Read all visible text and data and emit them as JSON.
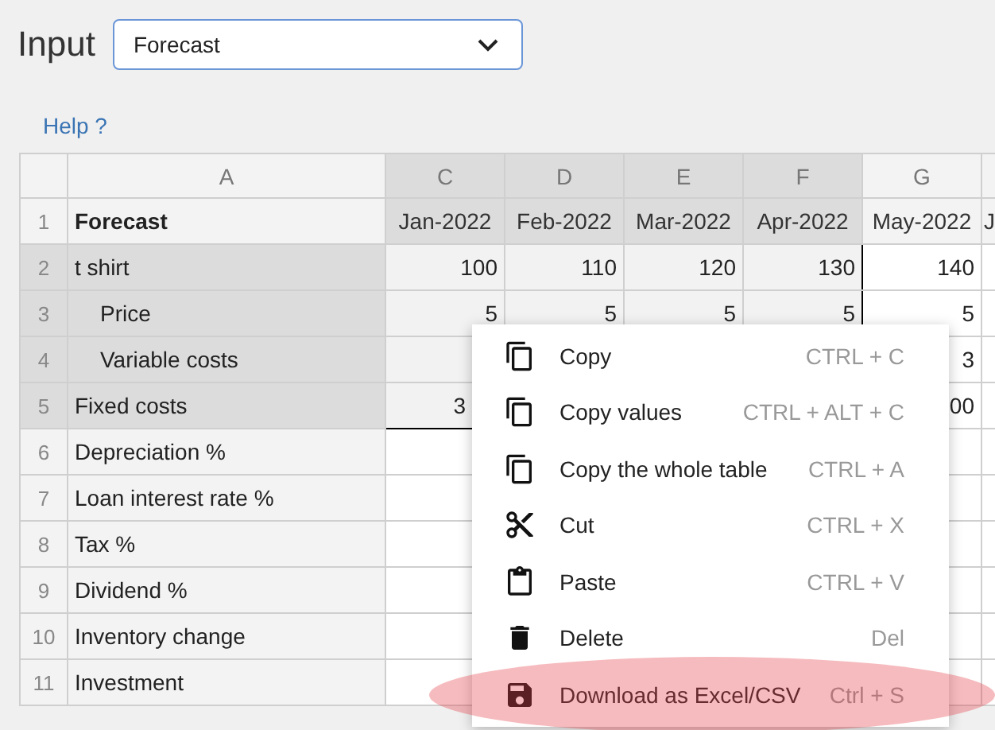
{
  "header": {
    "label": "Input",
    "select": {
      "value": "Forecast"
    }
  },
  "help_link": "Help ?",
  "sheet": {
    "columns": [
      {
        "label": "A",
        "selected": false
      },
      {
        "label": "C",
        "selected": true
      },
      {
        "label": "D",
        "selected": true
      },
      {
        "label": "E",
        "selected": true
      },
      {
        "label": "F",
        "selected": true
      },
      {
        "label": "G",
        "selected": false
      }
    ],
    "rows": [
      {
        "number": "1",
        "selected": false,
        "kind": "heading",
        "cells": [
          "Forecast",
          "Jan-2022",
          "Feb-2022",
          "Mar-2022",
          "Apr-2022",
          "May-2022",
          "J"
        ]
      },
      {
        "number": "2",
        "selected": true,
        "cells": [
          "t shirt",
          "100",
          "110",
          "120",
          "130",
          "140",
          null
        ],
        "children": [
          {
            "number": "3",
            "selected": true,
            "cells": [
              "Price",
              "5",
              "5",
              "5",
              "5",
              "5",
              null
            ]
          },
          {
            "number": "4",
            "selected": true,
            "cells": [
              "Variable costs",
              null,
              null,
              null,
              null,
              "3",
              null
            ]
          }
        ]
      },
      {
        "number": "5",
        "selected": true,
        "cells": [
          "Fixed costs",
          {
            "text": "3",
            "covered": true
          },
          null,
          null,
          null,
          "00",
          null
        ]
      },
      {
        "number": "6",
        "selected": false,
        "cells": [
          "Depreciation %",
          null,
          null,
          null,
          null,
          null,
          null
        ]
      },
      {
        "number": "7",
        "selected": false,
        "cells": [
          "Loan interest rate %",
          null,
          null,
          null,
          null,
          null,
          null
        ]
      },
      {
        "number": "8",
        "selected": false,
        "cells": [
          "Tax %",
          null,
          null,
          null,
          null,
          null,
          null
        ]
      },
      {
        "number": "9",
        "selected": false,
        "cells": [
          "Dividend %",
          null,
          null,
          null,
          null,
          null,
          null
        ]
      },
      {
        "number": "10",
        "selected": false,
        "cells": [
          "Inventory change",
          null,
          null,
          null,
          null,
          null,
          null
        ]
      },
      {
        "number": "11",
        "selected": false,
        "cells": [
          "Investment",
          null,
          null,
          null,
          null,
          null,
          null
        ]
      }
    ]
  },
  "context_menu": {
    "items": [
      {
        "kind": "copy",
        "label": "Copy",
        "shortcut": "CTRL + C",
        "highlighted": false
      },
      {
        "kind": "copy",
        "label": "Copy values",
        "shortcut": "CTRL + ALT + C",
        "highlighted": false
      },
      {
        "kind": "copy",
        "label": "Copy the whole table",
        "shortcut": "CTRL + A",
        "highlighted": false
      },
      {
        "kind": "cut",
        "label": "Cut",
        "shortcut": "CTRL + X",
        "highlighted": false
      },
      {
        "kind": "paste",
        "label": "Paste",
        "shortcut": "CTRL + V",
        "highlighted": false
      },
      {
        "kind": "delete",
        "label": "Delete",
        "shortcut": "Del",
        "highlighted": false
      },
      {
        "kind": "save",
        "label": "Download as Excel/CSV",
        "shortcut": "Ctrl + S",
        "highlighted": true
      }
    ]
  }
}
